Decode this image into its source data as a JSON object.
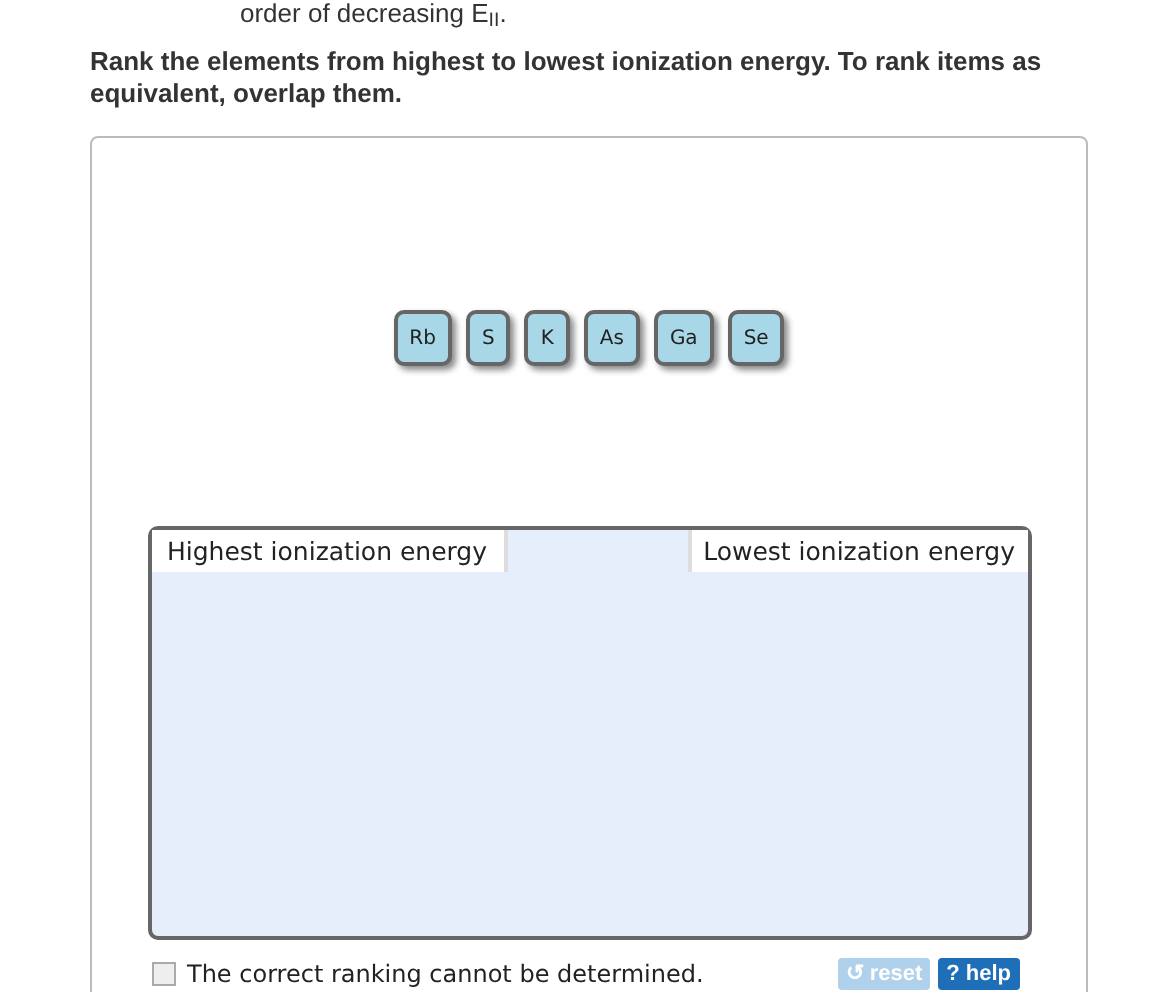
{
  "intro_tail": "order of decreasing E$_{II}$.",
  "instructions": "Rank the elements from highest to lowest ionization energy. To rank items as equivalent, overlap them.",
  "tiles": [
    {
      "label": "Rb"
    },
    {
      "label": "S"
    },
    {
      "label": "K"
    },
    {
      "label": "As"
    },
    {
      "label": "Ga"
    },
    {
      "label": "Se"
    }
  ],
  "ranking": {
    "left_label": "Highest ionization energy",
    "right_label": "Lowest ionization energy"
  },
  "cannot_determine": {
    "label": "The correct ranking cannot be determined.",
    "checked": false
  },
  "buttons": [
    {
      "kind": "reset",
      "icon": "↺",
      "label": "reset",
      "disabled": true
    },
    {
      "kind": "help",
      "icon": "?",
      "label": "help",
      "disabled": false
    }
  ]
}
